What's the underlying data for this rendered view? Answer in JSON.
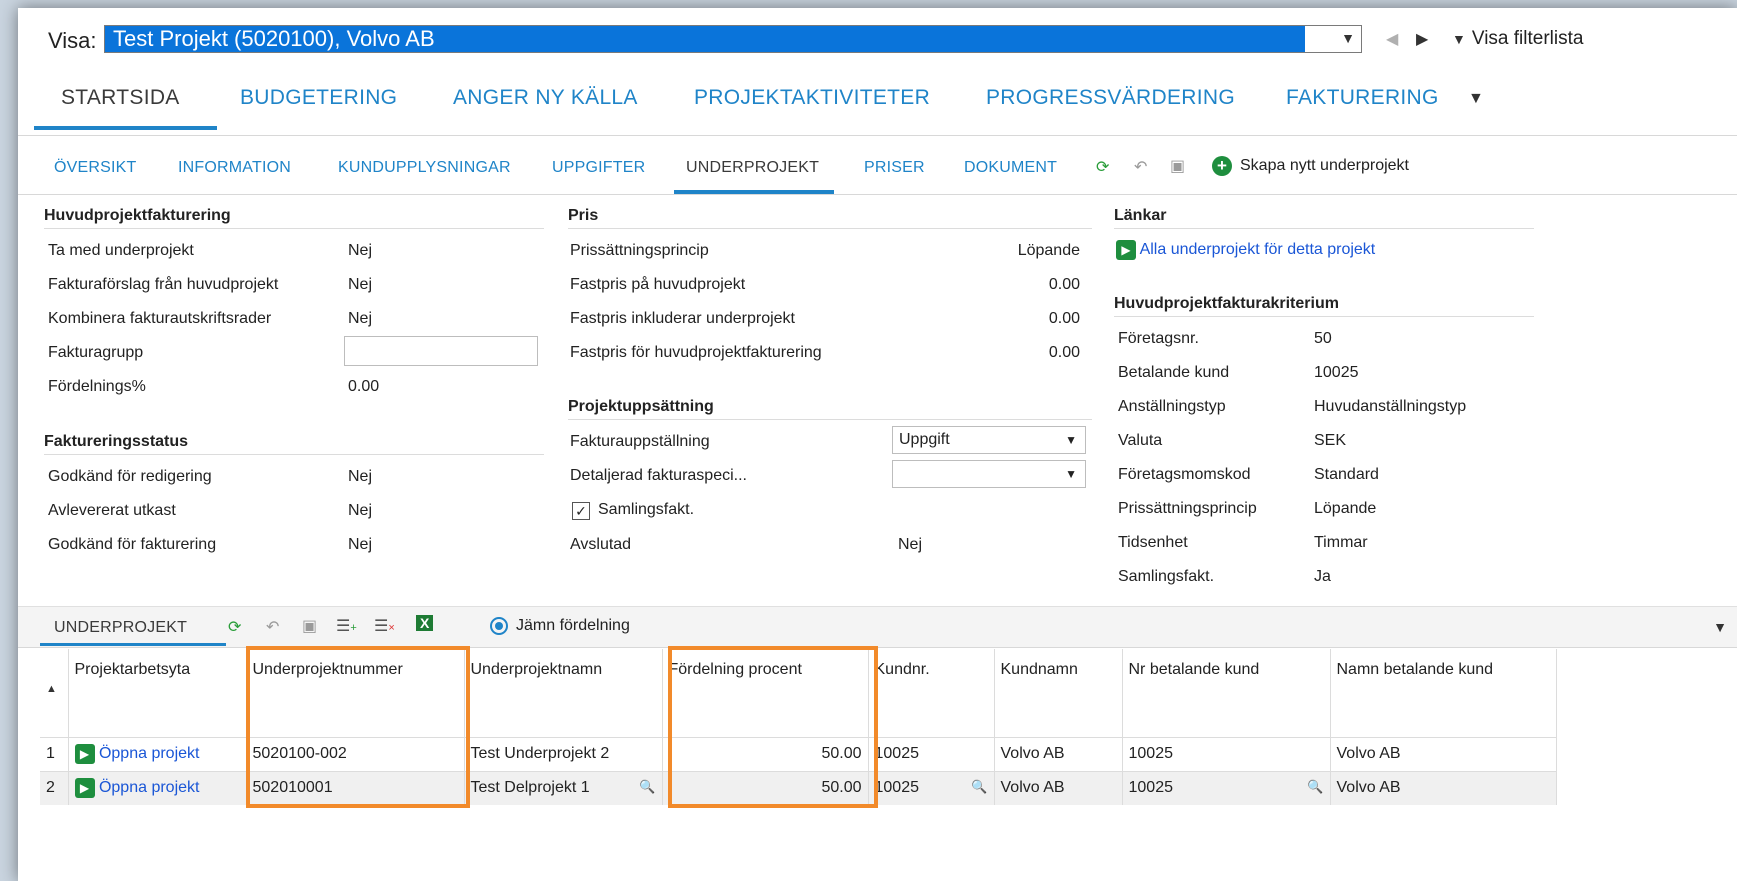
{
  "top": {
    "visa_label": "Visa:",
    "visa_value": "Test Projekt (5020100), Volvo AB",
    "filter_label": "Visa filterlista"
  },
  "main_tabs": [
    "STARTSIDA",
    "BUDGETERING",
    "ANGER NY KÄLLA",
    "PROJEKTAKTIVITETER",
    "PROGRESSVÄRDERING",
    "FAKTURERING"
  ],
  "sub_tabs": [
    "ÖVERSIKT",
    "INFORMATION",
    "KUNDUPPLYSNINGAR",
    "UPPGIFTER",
    "UNDERPROJEKT",
    "PRISER",
    "DOKUMENT"
  ],
  "toolbar": {
    "create_label": "Skapa nytt underprojekt"
  },
  "huvudfakt": {
    "title": "Huvudprojektfakturering",
    "rows": [
      {
        "label": "Ta med underprojekt",
        "value": "Nej"
      },
      {
        "label": "Fakturaförslag från huvudprojekt",
        "value": "Nej"
      },
      {
        "label": "Kombinera fakturautskriftsrader",
        "value": "Nej"
      },
      {
        "label": "Fakturagrupp",
        "value": ""
      },
      {
        "label": "Fördelnings%",
        "value": "0.00"
      }
    ]
  },
  "faktstatus": {
    "title": "Faktureringsstatus",
    "rows": [
      {
        "label": "Godkänd för redigering",
        "value": "Nej"
      },
      {
        "label": "Avlevererat utkast",
        "value": "Nej"
      },
      {
        "label": "Godkänd för fakturering",
        "value": "Nej"
      }
    ]
  },
  "pris": {
    "title": "Pris",
    "rows": [
      {
        "label": "Prissättningsprincip",
        "value": "Löpande"
      },
      {
        "label": "Fastpris på huvudprojekt",
        "value": "0.00"
      },
      {
        "label": "Fastpris inkluderar underprojekt",
        "value": "0.00"
      },
      {
        "label": "Fastpris för huvudprojektfakturering",
        "value": "0.00"
      }
    ]
  },
  "projupps": {
    "title": "Projektuppsättning",
    "fakturauppstallning_label": "Fakturauppställning",
    "fakturauppstallning_value": "Uppgift",
    "detaljerad_label": "Detaljerad fakturaspeci...",
    "detaljerad_value": "",
    "samlingsfakt_label": "Samlingsfakt.",
    "samlingsfakt_checked": true,
    "avslutad_label": "Avslutad",
    "avslutad_value": "Nej"
  },
  "lankar": {
    "title": "Länkar",
    "link": "Alla underprojekt för detta projekt"
  },
  "kriterium": {
    "title": "Huvudprojektfakturakriterium",
    "rows": [
      {
        "label": "Företagsnr.",
        "value": "50"
      },
      {
        "label": "Betalande kund",
        "value": "10025"
      },
      {
        "label": "Anställningstyp",
        "value": "Huvudanställningstyp"
      },
      {
        "label": "Valuta",
        "value": "SEK"
      },
      {
        "label": "Företagsmomskod",
        "value": "Standard"
      },
      {
        "label": "Prissättningsprincip",
        "value": "Löpande"
      },
      {
        "label": "Tidsenhet",
        "value": "Timmar"
      },
      {
        "label": "Samlingsfakt.",
        "value": "Ja"
      }
    ]
  },
  "grid": {
    "tab_label": "UNDERPROJEKT",
    "distribute_label": "Jämn fördelning",
    "columns": [
      "Projektarbetsyta",
      "Underprojektnummer",
      "Underprojektnamn",
      "Fördelning procent",
      "Kundnr.",
      "Kundnamn",
      "Nr betalande kund",
      "Namn betalande kund"
    ],
    "rows": [
      {
        "n": "1",
        "link": "Öppna projekt",
        "num": "5020100-002",
        "name": "Test Underprojekt 2",
        "pct": "50.00",
        "kundnr": "10025",
        "kundnamn": "Volvo AB",
        "nrbet": "10025",
        "namnbet": "Volvo AB"
      },
      {
        "n": "2",
        "link": "Öppna projekt",
        "num": "502010001",
        "name": "Test Delprojekt 1",
        "pct": "50.00",
        "kundnr": "10025",
        "kundnamn": "Volvo AB",
        "nrbet": "10025",
        "namnbet": "Volvo AB"
      }
    ]
  },
  "colors": {
    "accent": "#1f84c8",
    "selection": "#0a74da",
    "highlight": "#f28a2a",
    "green": "#1e8e3e"
  }
}
